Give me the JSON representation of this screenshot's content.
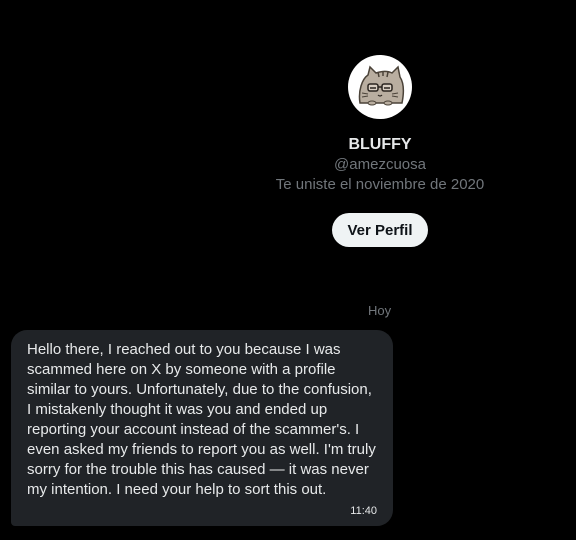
{
  "profile": {
    "avatar_icon": "pusheen-cat-avatar-icon",
    "display_name": "BLUFFY",
    "handle": "@amezcuosa",
    "joined": "Te uniste el noviembre de 2020",
    "view_profile_label": "Ver Perfil"
  },
  "conversation": {
    "day_separator": "Hoy",
    "messages": [
      {
        "text": "Hello there, I reached out to you because I was scammed here on X by someone with a profile similar to yours. Unfortunately, due to the confusion, I mistakenly thought it was you and ended up reporting your account instead of the scammer's. I even asked my friends to report you as well. I'm truly sorry for the trouble this has caused — it was never my intention. I need your help to sort this out.",
        "time": "11:40"
      }
    ]
  },
  "colors": {
    "background": "#000000",
    "bubble": "#202327",
    "primary_text": "#e7e9ea",
    "secondary_text": "#71767b",
    "button_bg": "#eff3f4"
  }
}
